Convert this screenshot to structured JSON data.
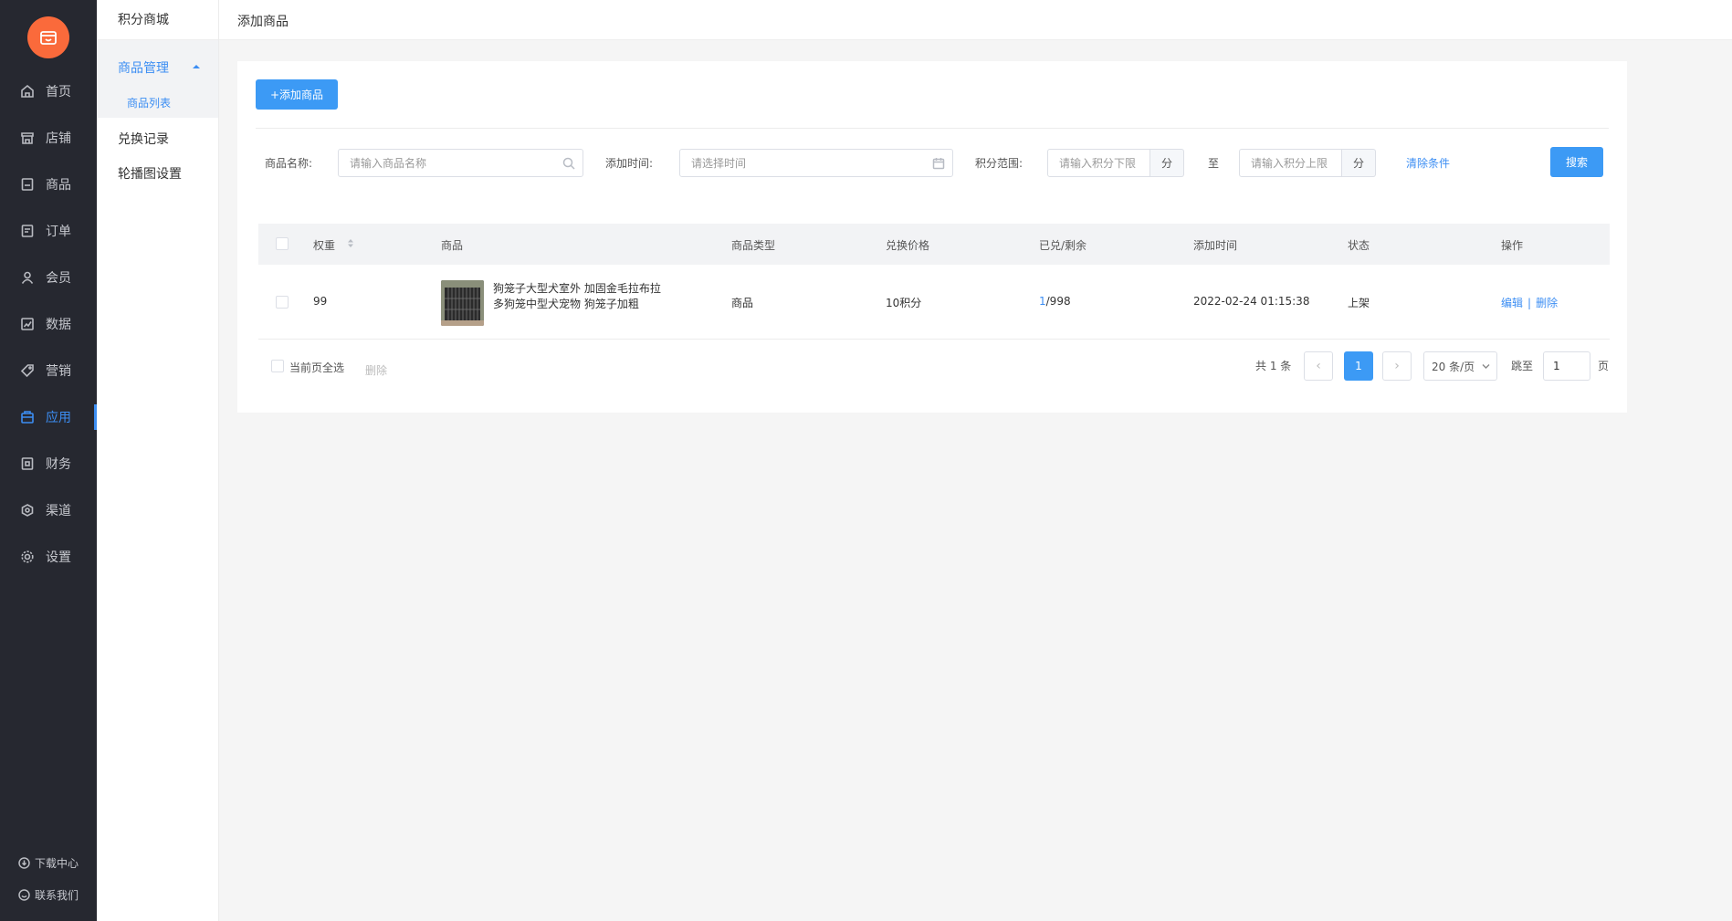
{
  "rail": {
    "items": [
      {
        "label": "首页",
        "icon": "home-icon"
      },
      {
        "label": "店铺",
        "icon": "store-icon"
      },
      {
        "label": "商品",
        "icon": "goods-icon"
      },
      {
        "label": "订单",
        "icon": "order-icon"
      },
      {
        "label": "会员",
        "icon": "member-icon"
      },
      {
        "label": "数据",
        "icon": "chart-icon"
      },
      {
        "label": "营销",
        "icon": "tag-icon"
      },
      {
        "label": "应用",
        "icon": "app-icon",
        "active": true
      },
      {
        "label": "财务",
        "icon": "finance-icon"
      },
      {
        "label": "渠道",
        "icon": "channel-icon"
      },
      {
        "label": "设置",
        "icon": "gear-icon"
      }
    ],
    "footer": {
      "download": "下载中心",
      "contact": "联系我们"
    },
    "accent_color": "#3c8ef3",
    "logo_color": "#fa6a3b"
  },
  "subnav": {
    "title": "积分商城",
    "group": {
      "label": "商品管理",
      "child": "商品列表"
    },
    "links": [
      "兑换记录",
      "轮播图设置"
    ]
  },
  "header": {
    "breadcrumb": "添加商品"
  },
  "toolbar": {
    "add_label": "+添加商品"
  },
  "filters": {
    "name_label": "商品名称:",
    "name_placeholder": "请输入商品名称",
    "time_label": "添加时间:",
    "time_placeholder": "请选择时间",
    "points_label": "积分范围:",
    "points_min_placeholder": "请输入积分下限",
    "points_max_placeholder": "请输入积分上限",
    "unit": "分",
    "to": "至",
    "clear_label": "清除条件",
    "search_label": "搜索"
  },
  "table": {
    "columns": [
      "权重",
      "商品",
      "商品类型",
      "兑换价格",
      "已兑/剩余",
      "添加时间",
      "状态",
      "操作"
    ],
    "rows": [
      {
        "weight": "99",
        "product": "狗笼子大型犬室外 加固金毛拉布拉多狗笼中型犬宠物 狗笼子加粗",
        "type": "商品",
        "price": "10积分",
        "redeemed": "1",
        "remaining": "/998",
        "added": "2022-02-24 01:15:38",
        "status": "上架",
        "edit": "编辑",
        "sep": "|",
        "delete": "删除"
      }
    ]
  },
  "footer": {
    "select_all": "当前页全选",
    "delete": "删除",
    "total": "共 1 条",
    "prev": "‹",
    "next": "›",
    "current_page": "1",
    "page_size": "20 条/页",
    "jump_label": "跳至",
    "jump_value": "1",
    "page_unit": "页"
  }
}
